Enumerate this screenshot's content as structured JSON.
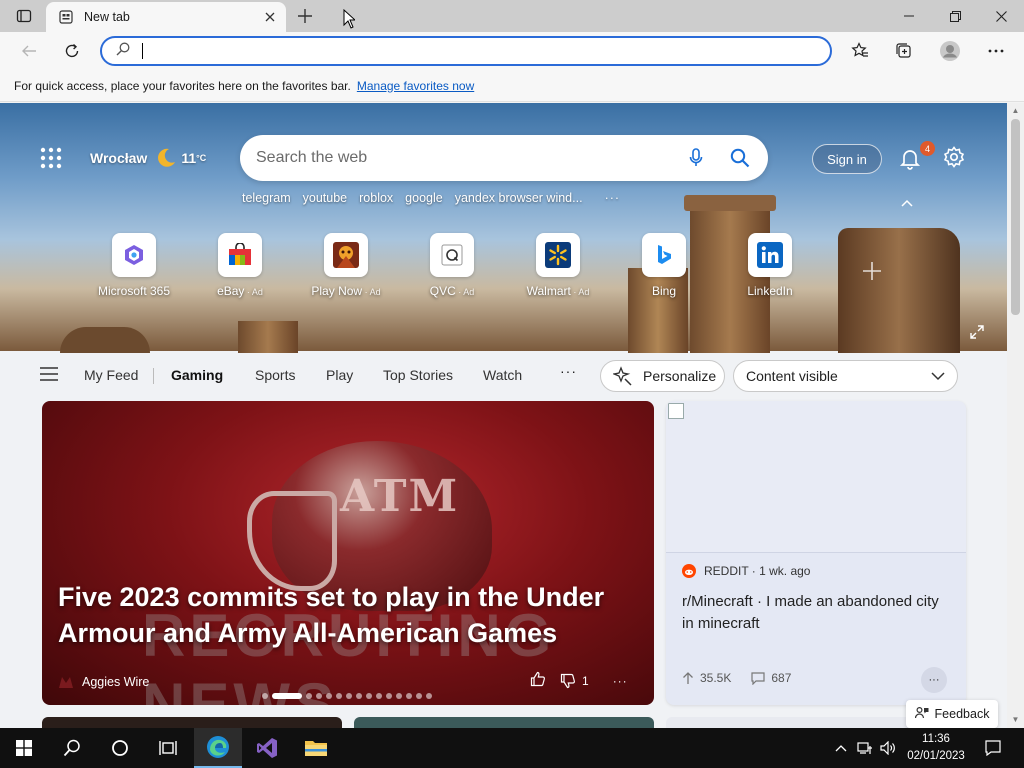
{
  "browser": {
    "tab_title": "New tab",
    "address_value": "",
    "favbar_message": "For quick access, place your favorites here on the favorites bar.",
    "favbar_link": "Manage favorites now"
  },
  "header": {
    "location": "Wrocław",
    "temperature": "11",
    "temperature_unit": "°C",
    "search_placeholder": "Search the web",
    "sign_in": "Sign in",
    "notification_count": "4",
    "trending": [
      "telegram",
      "youtube",
      "roblox",
      "google",
      "yandex browser wind..."
    ]
  },
  "tiles": [
    {
      "label": "Microsoft 365",
      "ad": ""
    },
    {
      "label": "eBay",
      "ad": " · Ad"
    },
    {
      "label": "Play Now",
      "ad": " · Ad"
    },
    {
      "label": "QVC",
      "ad": " · Ad"
    },
    {
      "label": "Walmart",
      "ad": " · Ad"
    },
    {
      "label": "Bing",
      "ad": ""
    },
    {
      "label": "LinkedIn",
      "ad": ""
    }
  ],
  "feed_nav": {
    "items": [
      "My Feed",
      "Gaming",
      "Sports",
      "Play",
      "Top Stories",
      "Watch"
    ],
    "active": "Gaming",
    "personalize": "Personalize",
    "content_visibility": "Content visible"
  },
  "main_card": {
    "headline": "Five 2023 commits set to play in the Under Armour and Army All-American Games",
    "source": "Aggies Wire",
    "dislike_count": "1",
    "image_text": {
      "helmet": "ATM",
      "background": "RECRUITING NEWS"
    }
  },
  "side_card": {
    "source": "REDDIT · 1 wk. ago",
    "headline": "r/Minecraft · I made an abandoned city in minecraft",
    "upvotes": "35.5K",
    "comments": "687"
  },
  "feedback": "Feedback",
  "taskbar": {
    "time": "11:36",
    "date": "02/01/2023"
  },
  "colors": {
    "accent": "#2b6bd8",
    "badge": "#e05a2b",
    "reddit": "#ff4500"
  }
}
